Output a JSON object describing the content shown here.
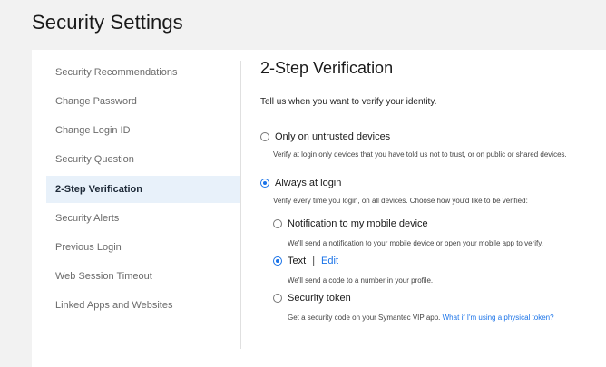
{
  "page": {
    "title": "Security Settings"
  },
  "sidebar": {
    "items": [
      {
        "label": "Security Recommendations",
        "active": false
      },
      {
        "label": "Change Password",
        "active": false
      },
      {
        "label": "Change Login ID",
        "active": false
      },
      {
        "label": "Security Question",
        "active": false
      },
      {
        "label": "2-Step Verification",
        "active": true
      },
      {
        "label": "Security Alerts",
        "active": false
      },
      {
        "label": "Previous Login",
        "active": false
      },
      {
        "label": "Web Session Timeout",
        "active": false
      },
      {
        "label": "Linked Apps and Websites",
        "active": false
      }
    ]
  },
  "main": {
    "section_title": "2-Step Verification",
    "intro": "Tell us when you want to verify your identity.",
    "options": {
      "untrusted": {
        "label": "Only on untrusted devices",
        "description": "Verify at login only devices that you have told us not to trust, or on public or shared devices.",
        "selected": false
      },
      "always": {
        "label": "Always at login",
        "description": "Verify every time you login, on all devices. Choose how you'd like to be verified:",
        "selected": true
      }
    },
    "methods": {
      "notification": {
        "label": "Notification to my mobile device",
        "description": "We'll send a notification to your mobile device or open your mobile app to verify.",
        "selected": false
      },
      "text": {
        "label": "Text",
        "separator": "|",
        "edit_label": "Edit",
        "description": "We'll send a code to a number in your profile.",
        "selected": true
      },
      "token": {
        "label": "Security token",
        "description": "Get a security code on your Symantec VIP app.",
        "link": "What if I'm using a physical token?",
        "selected": false
      }
    }
  },
  "colors": {
    "accent": "#1a73e8",
    "active_bg": "#e8f1fa",
    "page_bg": "#f2f2f2"
  }
}
